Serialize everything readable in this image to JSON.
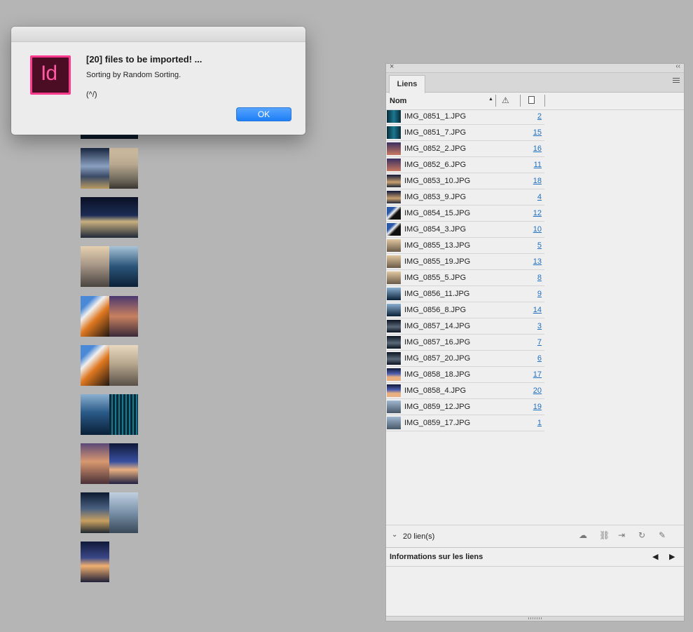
{
  "dialog": {
    "app_icon_text": "Id",
    "title": "[20] files to be imported! ...",
    "message": "Sorting by Random Sorting.",
    "subtext": "(^/)",
    "ok_label": "OK"
  },
  "panel": {
    "tab_label": "Liens",
    "column_name": "Nom",
    "links": [
      {
        "name": "IMG_0851_1.JPG",
        "page": "2"
      },
      {
        "name": "IMG_0851_7.JPG",
        "page": "15"
      },
      {
        "name": "IMG_0852_2.JPG",
        "page": "16"
      },
      {
        "name": "IMG_0852_6.JPG",
        "page": "11"
      },
      {
        "name": "IMG_0853_10.JPG",
        "page": "18"
      },
      {
        "name": "IMG_0853_9.JPG",
        "page": "4"
      },
      {
        "name": "IMG_0854_15.JPG",
        "page": "12"
      },
      {
        "name": "IMG_0854_3.JPG",
        "page": "10"
      },
      {
        "name": "IMG_0855_13.JPG",
        "page": "5"
      },
      {
        "name": "IMG_0855_19.JPG",
        "page": "13"
      },
      {
        "name": "IMG_0855_5.JPG",
        "page": "8"
      },
      {
        "name": "IMG_0856_11.JPG",
        "page": "9"
      },
      {
        "name": "IMG_0856_8.JPG",
        "page": "14"
      },
      {
        "name": "IMG_0857_14.JPG",
        "page": "3"
      },
      {
        "name": "IMG_0857_16.JPG",
        "page": "7"
      },
      {
        "name": "IMG_0857_20.JPG",
        "page": "6"
      },
      {
        "name": "IMG_0858_18.JPG",
        "page": "17"
      },
      {
        "name": "IMG_0858_4.JPG",
        "page": "20"
      },
      {
        "name": "IMG_0859_12.JPG",
        "page": "19"
      },
      {
        "name": "IMG_0859_17.JPG",
        "page": "1"
      }
    ],
    "count_label": "20 lien(s)",
    "info_title": "Informations sur les liens"
  },
  "colors": {
    "canvas": "#b5b5b5",
    "accent_button": "#1a7cf5",
    "link_page": "#1f6fc0",
    "indesign_icon": "#ff3a8e"
  }
}
